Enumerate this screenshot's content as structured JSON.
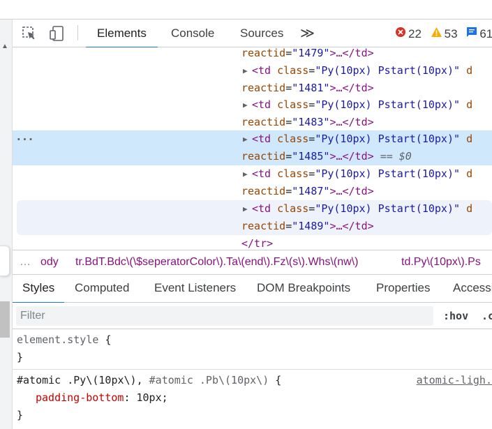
{
  "toolbar": {
    "tabs": [
      {
        "label": "Elements",
        "active": true
      },
      {
        "label": "Console",
        "active": false
      },
      {
        "label": "Sources",
        "active": false
      }
    ],
    "more_glyph": "≫",
    "errors": "22",
    "warnings": "53",
    "messages": "61"
  },
  "dom": {
    "line0": {
      "attr": "reactid",
      "value": "\"1479\"",
      "rest": ">…</td>"
    },
    "rows": [
      {
        "tag": "<td",
        "class_attr": "class",
        "class_value": "\"Py(10px) Pstart(10px)\"",
        "trail": "d",
        "reactid": "\"1481\"",
        "close": ">…</td>",
        "selected": false,
        "hovered": false
      },
      {
        "tag": "<td",
        "class_attr": "class",
        "class_value": "\"Py(10px) Pstart(10px)\"",
        "trail": "d",
        "reactid": "\"1483\"",
        "close": ">…</td>",
        "selected": false,
        "hovered": false
      },
      {
        "tag": "<td",
        "class_attr": "class",
        "class_value": "\"Py(10px) Pstart(10px)\"",
        "trail": "d",
        "reactid": "\"1485\"",
        "close": ">…</td>",
        "selected": true,
        "hovered": false,
        "marker": "== $0"
      },
      {
        "tag": "<td",
        "class_attr": "class",
        "class_value": "\"Py(10px) Pstart(10px)\"",
        "trail": "d",
        "reactid": "\"1487\"",
        "close": ">…</td>",
        "selected": false,
        "hovered": false
      },
      {
        "tag": "<td",
        "class_attr": "class",
        "class_value": "\"Py(10px) Pstart(10px)\"",
        "trail": "d",
        "reactid": "\"1489\"",
        "close": ">…</td>",
        "selected": false,
        "hovered": true
      }
    ],
    "reactid_attr": "reactid",
    "closing_tr": "</tr>",
    "dots": "···"
  },
  "breadcrumbs": {
    "ellipsis": "…",
    "items": [
      "ody",
      "tr.BdT.Bdc\\(\\$seperatorColor\\).Ta\\(end\\).Fz\\(s\\).Whs\\(nw\\)",
      "td.Py\\(10px\\).Ps"
    ]
  },
  "styles_tabs": [
    "Styles",
    "Computed",
    "Event Listeners",
    "DOM Breakpoints",
    "Properties",
    "Accessi"
  ],
  "filter": {
    "placeholder": "Filter",
    "hov": ":hov",
    "cls": ".c"
  },
  "rules": {
    "element_style": {
      "selector": "element.style",
      "open": "{",
      "close": "}"
    },
    "atomic": {
      "selector_a": "#atomic .Py\\(10px\\), ",
      "selector_b": "#atomic .Pb\\(10px\\)",
      "open": " {",
      "property": "padding-bottom",
      "colon": ": ",
      "value": "10px",
      "semicolon": ";",
      "close": "}",
      "source": "atomic-ligh."
    }
  },
  "colors": {
    "accent": "#1a73e8",
    "tag": "#881280",
    "attr_name": "#994500",
    "attr_value": "#1a1aa6",
    "selected_row": "#cfe8fc",
    "error": "#d93025",
    "warning": "#f9ab00",
    "message": "#1a73e8"
  },
  "icons": [
    "inspect-element-icon",
    "device-toolbar-icon",
    "error-icon",
    "warning-icon",
    "message-icon",
    "scroll-up-icon"
  ]
}
